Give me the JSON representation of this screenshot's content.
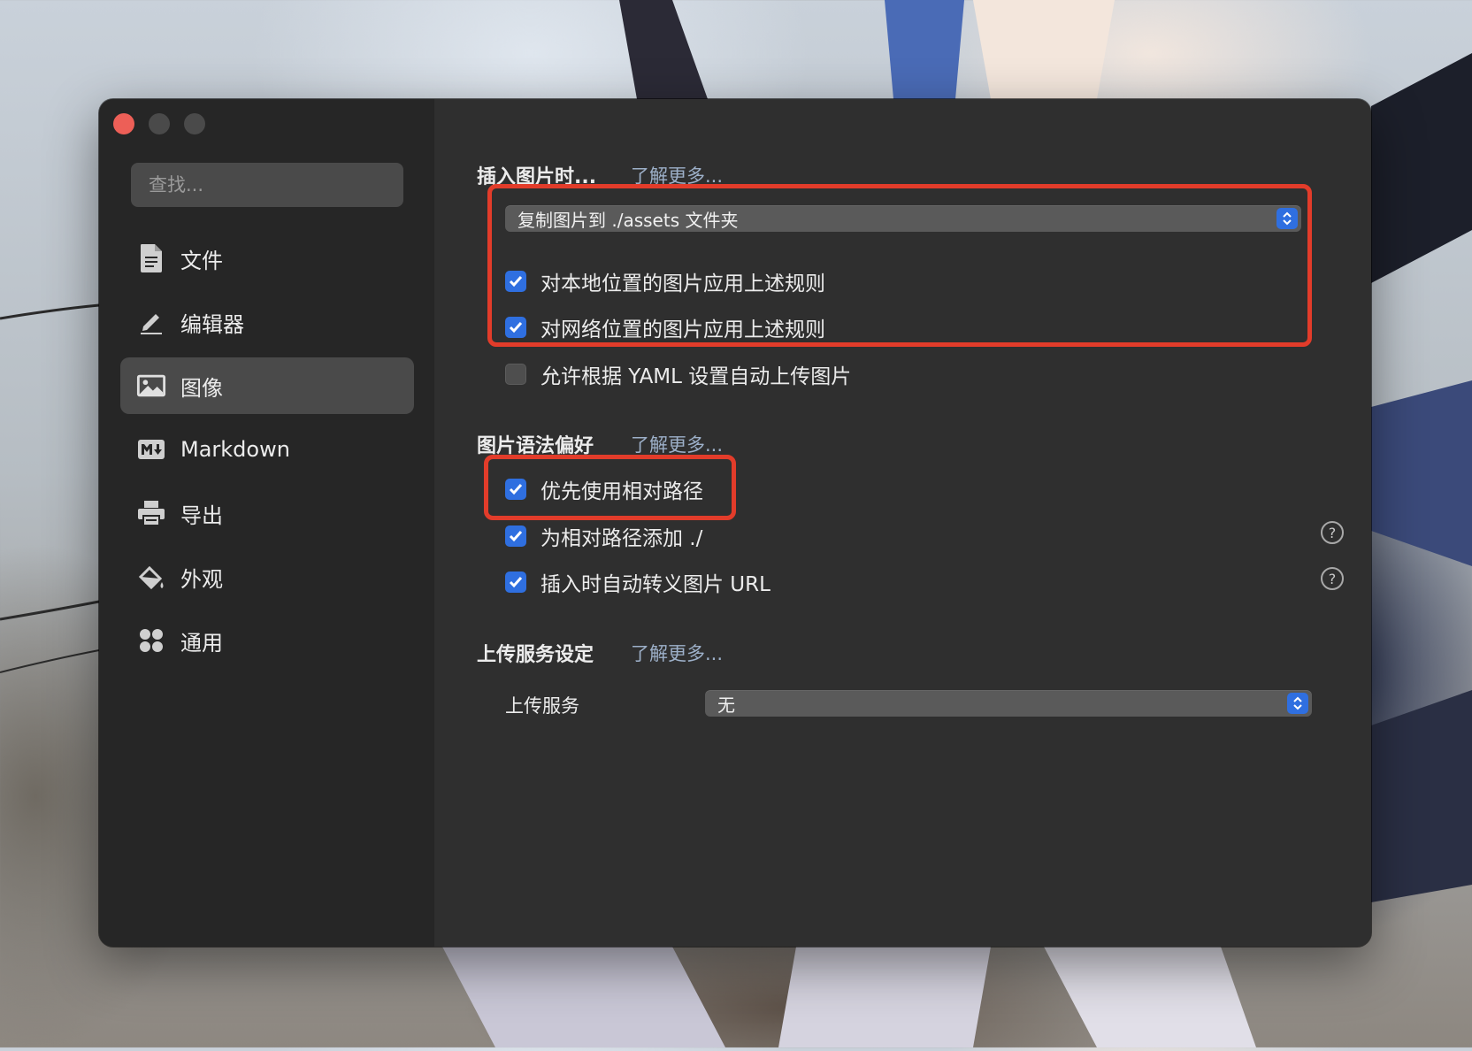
{
  "window": {
    "accent": "#2f6fe0",
    "highlight": "#e23c2a"
  },
  "sidebar": {
    "search_placeholder": "查找...",
    "items": [
      {
        "label": "文件",
        "icon": "document-icon",
        "active": false
      },
      {
        "label": "编辑器",
        "icon": "pencil-icon",
        "active": false
      },
      {
        "label": "图像",
        "icon": "image-icon",
        "active": true
      },
      {
        "label": "Markdown",
        "icon": "markdown-icon",
        "active": false
      },
      {
        "label": "导出",
        "icon": "printer-icon",
        "active": false
      },
      {
        "label": "外观",
        "icon": "paint-bucket-icon",
        "active": false
      },
      {
        "label": "通用",
        "icon": "grid-icon",
        "active": false
      }
    ]
  },
  "insert_image": {
    "title": "插入图片时...",
    "learn_more": "了解更多...",
    "action_select": "复制图片到 ./assets 文件夹",
    "options": [
      {
        "label": "对本地位置的图片应用上述规则",
        "checked": true
      },
      {
        "label": "对网络位置的图片应用上述规则",
        "checked": true
      },
      {
        "label": "允许根据 YAML 设置自动上传图片",
        "checked": false
      }
    ]
  },
  "image_syntax": {
    "title": "图片语法偏好",
    "learn_more": "了解更多...",
    "options": [
      {
        "label": "优先使用相对路径",
        "checked": true
      },
      {
        "label": "为相对路径添加 ./",
        "checked": true,
        "help": "?"
      },
      {
        "label": "插入时自动转义图片 URL",
        "checked": true,
        "help": "?"
      }
    ]
  },
  "upload": {
    "title": "上传服务设定",
    "learn_more": "了解更多...",
    "service_label": "上传服务",
    "service_value": "无"
  }
}
